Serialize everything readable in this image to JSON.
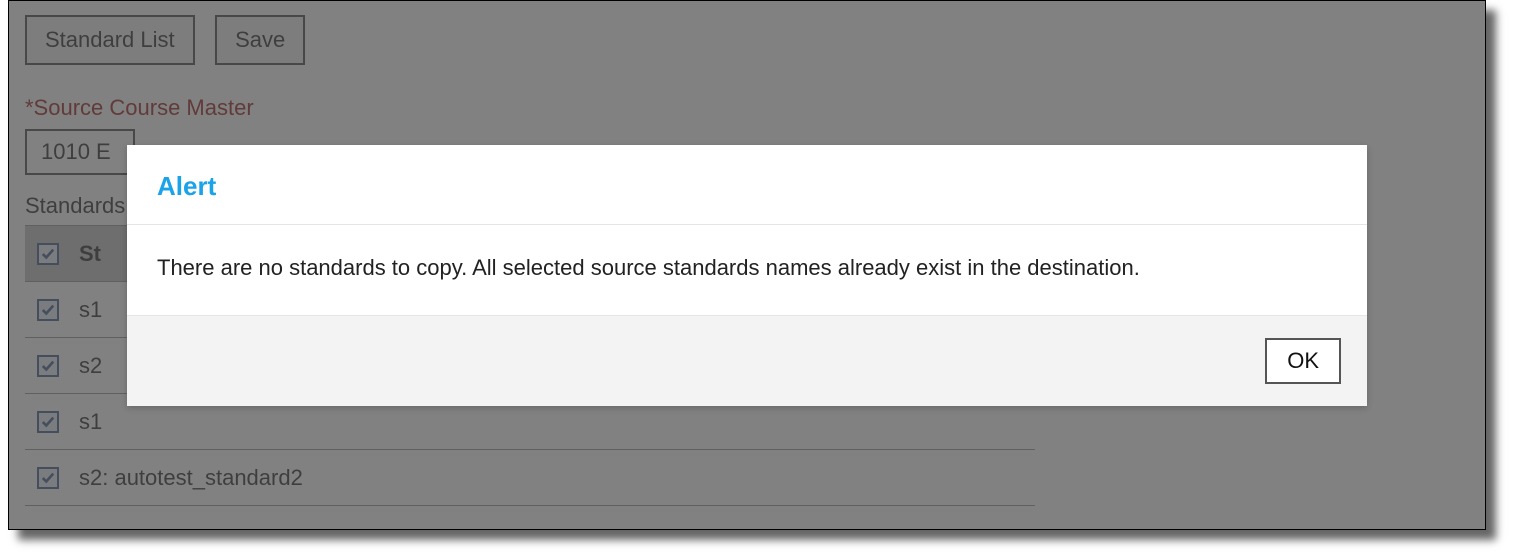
{
  "buttons": {
    "standard_list": "Standard List",
    "save": "Save"
  },
  "source_label": "*Source Course Master",
  "source_value": "1010 E",
  "standards_section": "Standards",
  "table": {
    "header": "St",
    "rows": [
      "s1",
      "s2",
      "s1",
      "s2: autotest_standard2"
    ]
  },
  "modal": {
    "title": "Alert",
    "message": "There are no standards to copy. All selected source standards names already exist in the destination.",
    "ok": "OK"
  }
}
